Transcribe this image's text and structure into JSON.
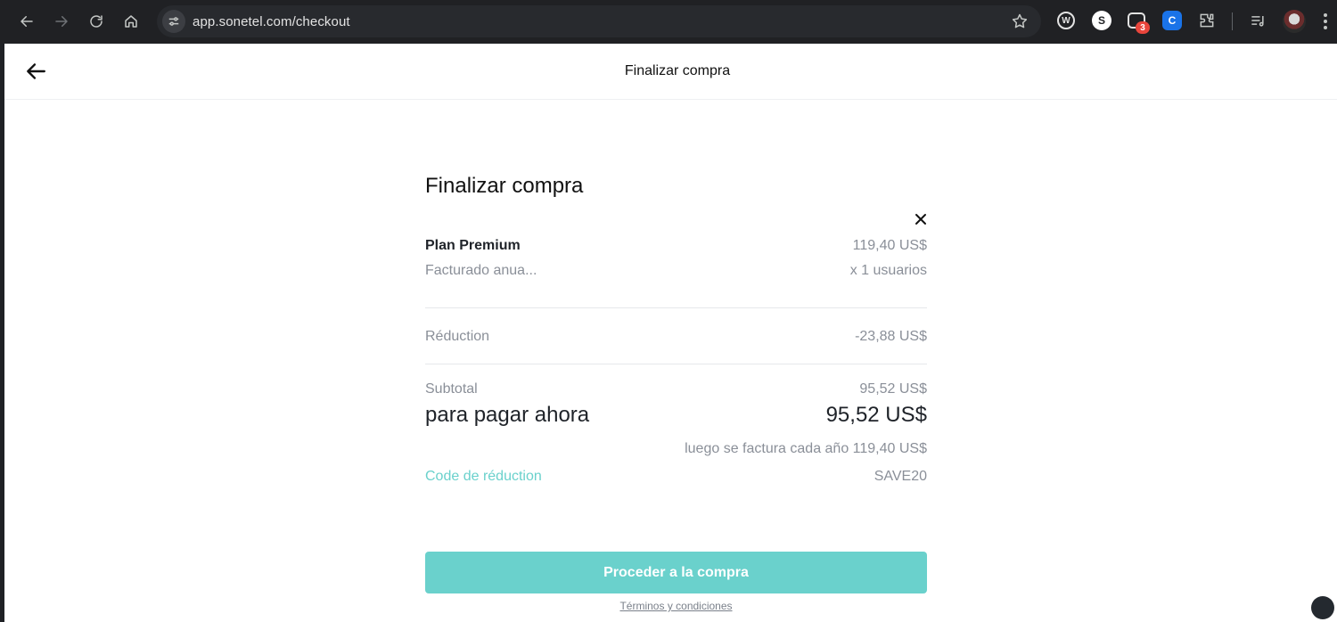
{
  "browser": {
    "url": "app.sonetel.com/checkout",
    "extension_badge": "3",
    "ext_w_letter": "W",
    "ext_s_letter": "S",
    "ext_c_letter": "C",
    "icons": [
      "back-icon",
      "forward-icon",
      "reload-icon",
      "home-icon",
      "site-info-icon",
      "bookmark-star-icon",
      "extensions-icon",
      "media-controls-icon",
      "menu-icon"
    ]
  },
  "header": {
    "title": "Finalizar compra"
  },
  "checkout": {
    "title": "Finalizar compra",
    "plan": {
      "name": "Plan Premium",
      "price": "119,40 US$",
      "billing": "Facturado anua...",
      "quantity": "x 1 usuarios"
    },
    "discount": {
      "label": "Réduction",
      "value": "-23,88 US$"
    },
    "subtotal": {
      "label": "Subtotal",
      "value": "95,52 US$"
    },
    "pay_now": {
      "label": "para pagar ahora",
      "value": "95,52 US$"
    },
    "renewal_note": "luego se factura cada año 119,40 US$",
    "promo": {
      "label": "Code de réduction",
      "code": "SAVE20"
    },
    "cta_label": "Proceder a la compra",
    "terms_label": "Términos y condiciones"
  },
  "colors": {
    "accent": "#6ad1cc",
    "text_primary": "#1f2329",
    "text_muted": "#8a8f98",
    "chrome_bg": "#202124"
  }
}
